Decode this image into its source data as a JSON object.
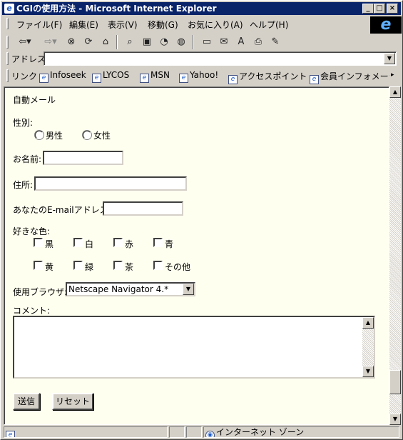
{
  "window": {
    "title": "CGIの使用方法 - Microsoft Internet Explorer",
    "min": "_",
    "max": "□",
    "close": "×"
  },
  "menu": [
    "ファイル(F)",
    "編集(E)",
    "表示(V)",
    "移動(G)",
    "お気に入り(A)",
    "ヘルプ(H)"
  ],
  "toolbar_icons": [
    "back-icon",
    "forward-icon",
    "stop-icon",
    "refresh-icon",
    "home-icon",
    "search-icon",
    "favorites-icon",
    "history-icon",
    "channels-icon",
    "fullscreen-icon",
    "mail-icon",
    "font-icon",
    "print-icon",
    "edit-icon"
  ],
  "address": {
    "label": "アドレス",
    "value": ""
  },
  "links": {
    "label": "リンク",
    "items": [
      "Infoseek",
      "LYCOS",
      "MSN",
      "Yahoo!",
      "アクセスポイント",
      "会員インフォメーシ"
    ]
  },
  "form": {
    "heading": "自動メール",
    "gender_label": "性別:",
    "gender_options": [
      "男性",
      "女性"
    ],
    "name_label": "お名前:",
    "address_label": "住所:",
    "email_label": "あなたのE-mailアドレス:",
    "color_label": "好きな色:",
    "colors": [
      "黒",
      "白",
      "赤",
      "青",
      "黄",
      "緑",
      "茶",
      "その他"
    ],
    "browser_label": "使用ブラウザ:",
    "browser_selected": "Netscape Navigator 4.*",
    "comment_label": "コメント:",
    "submit_label": "送信",
    "reset_label": "リセット"
  },
  "status": {
    "zone": "インターネット ゾーン"
  }
}
